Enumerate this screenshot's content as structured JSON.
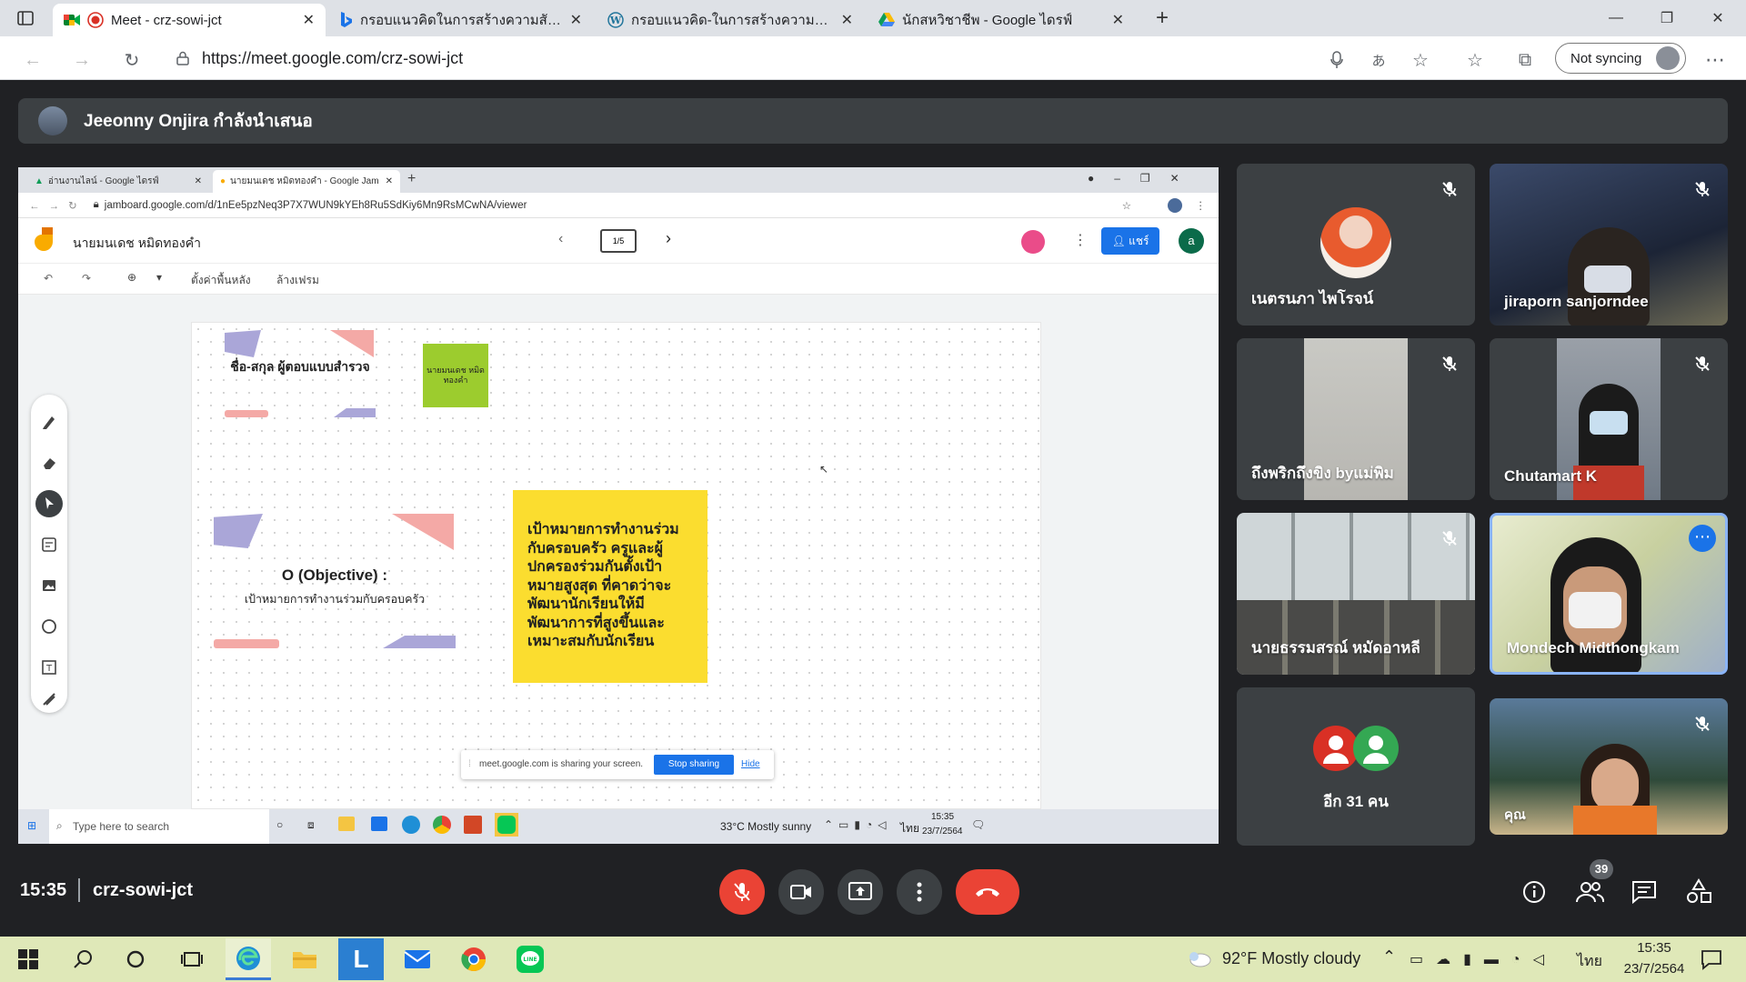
{
  "browser": {
    "tabs": [
      {
        "label": "Meet - crz-sowi-jct",
        "active": true
      },
      {
        "label": "กรอบแนวคิดในการสร้างความสัมพันธ์",
        "active": false
      },
      {
        "label": "กรอบแนวคิด-ในการสร้างความสัมพันธ์",
        "active": false
      },
      {
        "label": "นักสหวิชาชีพ - Google ไดรฟ์",
        "active": false
      }
    ],
    "url": "https://meet.google.com/crz-sowi-jct",
    "sync_label": "Not syncing"
  },
  "presenter": {
    "text": "Jeeonny Onjira กำลังนำเสนอ"
  },
  "shared": {
    "tabs": [
      {
        "label": "อ่านงานไลน์ - Google ไดรฟ์"
      },
      {
        "label": "นายมนเดช หมิดทองคำ - Google Jam"
      }
    ],
    "url": "jamboard.google.com/d/1nEe5pzNeq3P7X7WUN9kYEh8Ru5SdKiy6Mn9RsMCwNA/viewer",
    "jam_title": "นายมนเดช หมิดทองคำ",
    "page_indicator": "1/5",
    "share_label": "แชร์",
    "avatar_letter": "a",
    "tool_set_bg": "ตั้งค่าพื้นหลัง",
    "tool_clear": "ล้างเฟรม",
    "card1": "ชื่อ-สกุล ผู้ตอบแบบสำรวจ",
    "sticky_green": "นายมนเดช หมิดทองคำ",
    "card2_title": "O (Objective) :",
    "card2_sub": "เป้าหมายการทำงานร่วมกับครอบครัว",
    "sticky_yellow": "เป้าหมายการทำงานร่วมกับครอบครัว ครูและผู้ปกครองร่วมกันตั้งเป้าหมายสูงสุด ที่คาดว่าจะพัฒนานักเรียนให้มีพัฒนาการที่สูงขึ้นและเหมาะสมกับนักเรียน",
    "share_notice": "meet.google.com is sharing your screen.",
    "stop_label": "Stop sharing",
    "hide_label": "Hide",
    "search_placeholder": "Type here to search",
    "weather": "33°C  Mostly sunny",
    "lang": "ไทย",
    "time": "15:35",
    "date": "23/7/2564"
  },
  "participants": [
    {
      "name": "เนตรนภา ไพโรจน์"
    },
    {
      "name": "jiraporn sanjorndee"
    },
    {
      "name": "ถึงพริกถึงขิง byแม่พิม"
    },
    {
      "name": "Chutamart K"
    },
    {
      "name": "นายธรรมสรณ์ หมัดอาหลี"
    },
    {
      "name": "Mondech Midthongkam"
    },
    {
      "name": "อีก 31 คน"
    },
    {
      "name": "คุณ"
    }
  ],
  "meeting": {
    "time": "15:35",
    "code": "crz-sowi-jct",
    "people_count": "39"
  },
  "taskbar": {
    "weather": "92°F  Mostly cloudy",
    "lang": "ไทย",
    "time": "15:35",
    "date": "23/7/2564"
  },
  "colors": {
    "end_call": "#ea4335",
    "accent": "#1a73e8",
    "sticky_yellow": "#fbdd2f",
    "sticky_green": "#9ccc2e"
  }
}
